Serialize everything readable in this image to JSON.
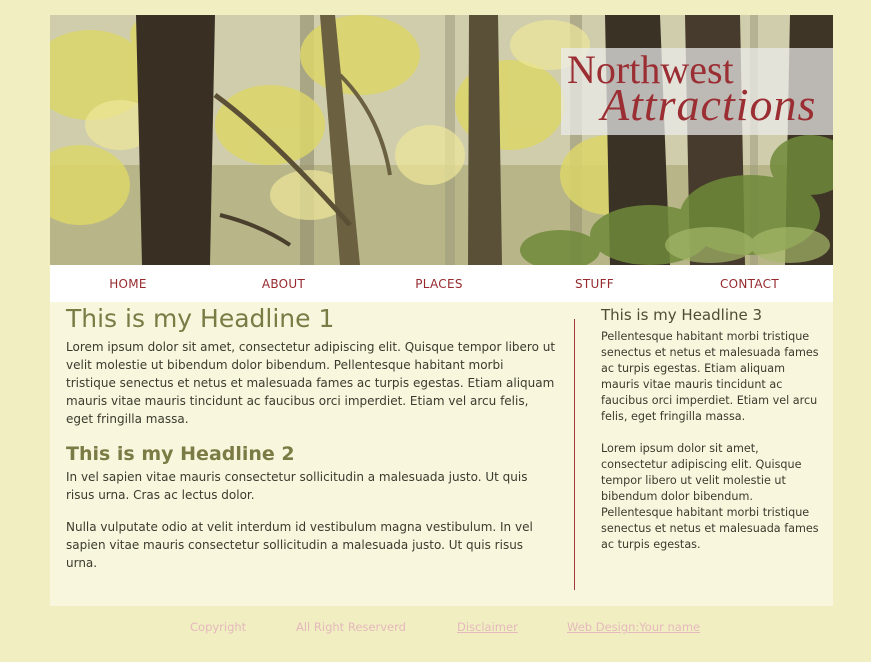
{
  "brand": {
    "line1": "Northwest",
    "line2": "Attractions"
  },
  "nav": [
    {
      "label": "HOME"
    },
    {
      "label": "ABOUT"
    },
    {
      "label": "PLACES"
    },
    {
      "label": "STUFF"
    },
    {
      "label": "CONTACT"
    }
  ],
  "main": {
    "headline1": "This is my Headline 1",
    "para1": "Lorem ipsum dolor sit amet, consectetur adipiscing elit. Quisque tempor libero ut velit molestie ut bibendum dolor bibendum. Pellentesque habitant morbi tristique senectus et netus et malesuada fames ac turpis egestas. Etiam aliquam mauris vitae mauris tincidunt ac faucibus orci imperdiet. Etiam vel arcu felis, eget fringilla massa.",
    "headline2": "This is my Headline 2",
    "para2": "In vel sapien vitae mauris consectetur sollicitudin a malesuada justo. Ut quis risus urna. Cras ac lectus dolor.",
    "para3": "Nulla vulputate odio at velit interdum id vestibulum magna vestibulum. In vel sapien vitae mauris consectetur sollicitudin a malesuada justo. Ut quis risus urna."
  },
  "sidebar": {
    "headline3": "This is my Headline 3",
    "para1": "Pellentesque habitant morbi tristique senectus et netus et malesuada fames ac turpis egestas. Etiam aliquam mauris vitae mauris tincidunt ac faucibus orci imperdiet. Etiam vel arcu felis, eget fringilla massa.",
    "para2": "Lorem ipsum dolor sit amet, consectetur adipiscing elit. Quisque tempor libero ut velit molestie ut bibendum dolor bibendum. Pellentesque habitant morbi tristique senectus et netus et malesuada fames ac turpis egestas."
  },
  "footer": {
    "copyright": "Copyright",
    "rights": "All Right Reserverd",
    "disclaimer": "Disclaimer",
    "design": "Web Design:Your name"
  },
  "colors": {
    "page_bg": "#f1efc1",
    "content_bg": "#f8f7dd",
    "accent_red": "#962a2e",
    "headline_olive": "#7a7b45",
    "footer_pink": "#e5b8bd"
  },
  "icons": {
    "banner": "forest-photo"
  }
}
